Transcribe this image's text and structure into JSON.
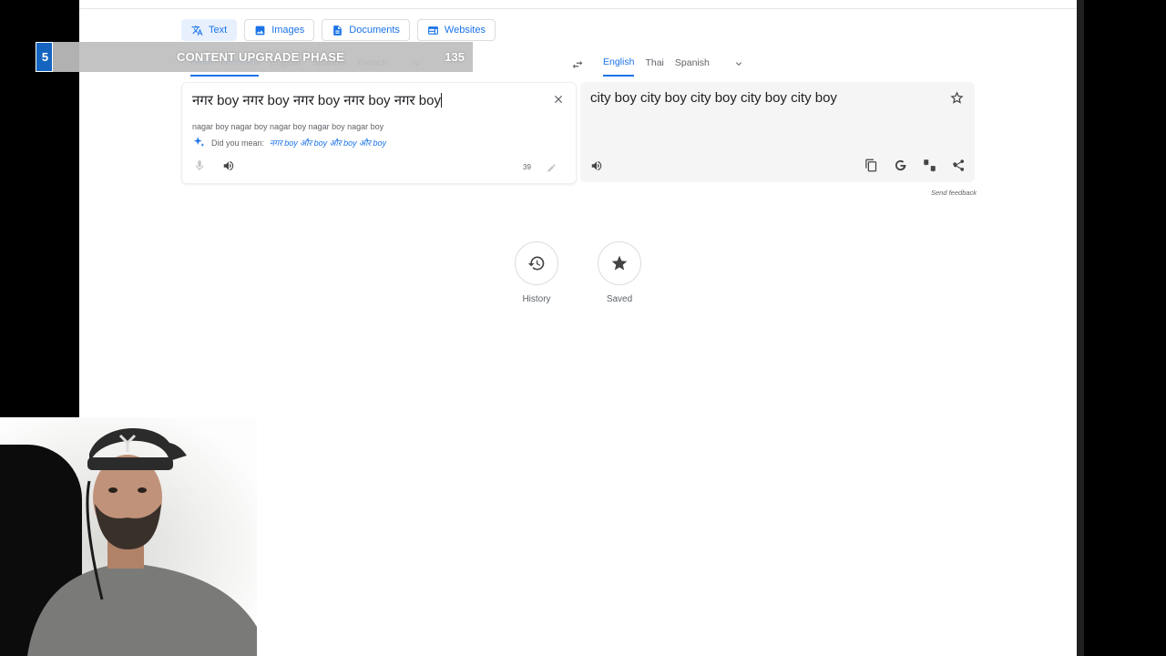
{
  "modes": [
    {
      "label": "Text",
      "icon": "translate-icon",
      "active": true
    },
    {
      "label": "Images",
      "icon": "image-icon"
    },
    {
      "label": "Documents",
      "icon": "document-icon"
    },
    {
      "label": "Websites",
      "icon": "website-icon"
    }
  ],
  "source_langs": [
    "Hindi - Detected",
    "English",
    "Spanish",
    "French"
  ],
  "target_langs": [
    "English",
    "Thai",
    "Spanish"
  ],
  "source": {
    "text": "नगर boy नगर boy नगर boy नगर boy नगर boy",
    "transliteration": "nagar boy nagar boy nagar boy nagar boy nagar boy",
    "did_you_mean_label": "Did you mean:",
    "suggestion": "नगर boy और boy और boy और boy",
    "char_count": "39"
  },
  "target": {
    "text": "city boy city boy city boy city boy city boy"
  },
  "send_feedback": "Send feedback",
  "history_label": "History",
  "saved_label": "Saved",
  "overlay": {
    "number": "5",
    "title": "CONTENT UPGRADE PHASE",
    "score": "135"
  },
  "colors": {
    "accent": "#1a73e8",
    "banner_num": "#1565c0"
  }
}
